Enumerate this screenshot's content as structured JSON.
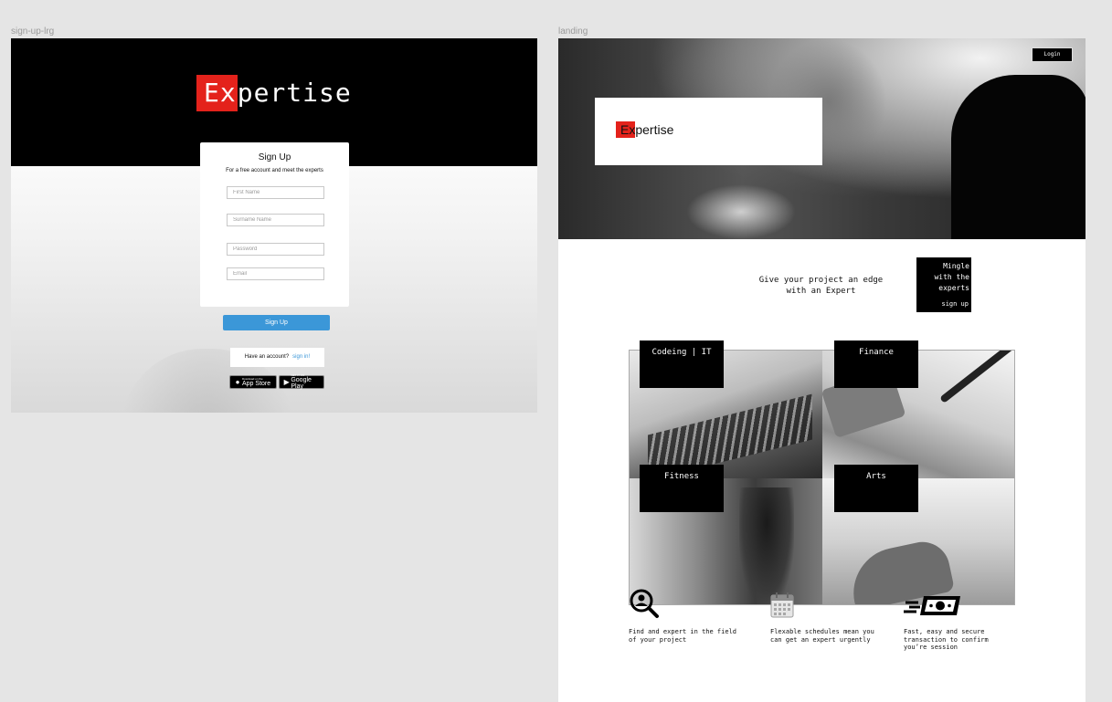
{
  "frames": {
    "signup_label": "sign-up-lrg",
    "landing_label": "landing"
  },
  "signup": {
    "logo": {
      "highlight": "Ex",
      "rest": "pertise"
    },
    "title": "Sign Up",
    "subtitle": "For a free account and meet the experts",
    "fields": {
      "first_name": "First Name",
      "surname": "Surname Name",
      "password": "Password",
      "email": "Email"
    },
    "submit_label": "Sign Up",
    "have_account": "Have an account?",
    "sign_in_link": "sign in!",
    "app_store": {
      "small": "Download on the",
      "big": "App Store"
    },
    "google_play": {
      "small": "GET IT ON",
      "big": "Google Play"
    }
  },
  "landing": {
    "login_label": "Login",
    "logo": {
      "highlight": "Ex",
      "rest": "pertise"
    },
    "edge_line1": "Give your project an edge",
    "edge_line2": "with an Expert",
    "mingle_line1": "Mingle",
    "mingle_line2": "with the",
    "mingle_line3": "experts",
    "mingle_signup": "sign up",
    "categories": [
      "Codeing | IT",
      "Finance",
      "Fitness",
      "Arts"
    ],
    "features": [
      {
        "icon": "magnifier-person-icon",
        "line1": "Find and expert in the field",
        "line2": "of your project",
        "line3": ""
      },
      {
        "icon": "calendar-icon",
        "line1": "Flexable schedules mean you",
        "line2": "can get an expert urgently",
        "line3": ""
      },
      {
        "icon": "fast-money-icon",
        "line1": "Fast, easy and secure",
        "line2": "transaction to confirm",
        "line3": "you’re session"
      }
    ]
  },
  "colors": {
    "accent_red": "#e4221b",
    "button_blue": "#3b97d8",
    "canvas": "#e5e5e5"
  }
}
